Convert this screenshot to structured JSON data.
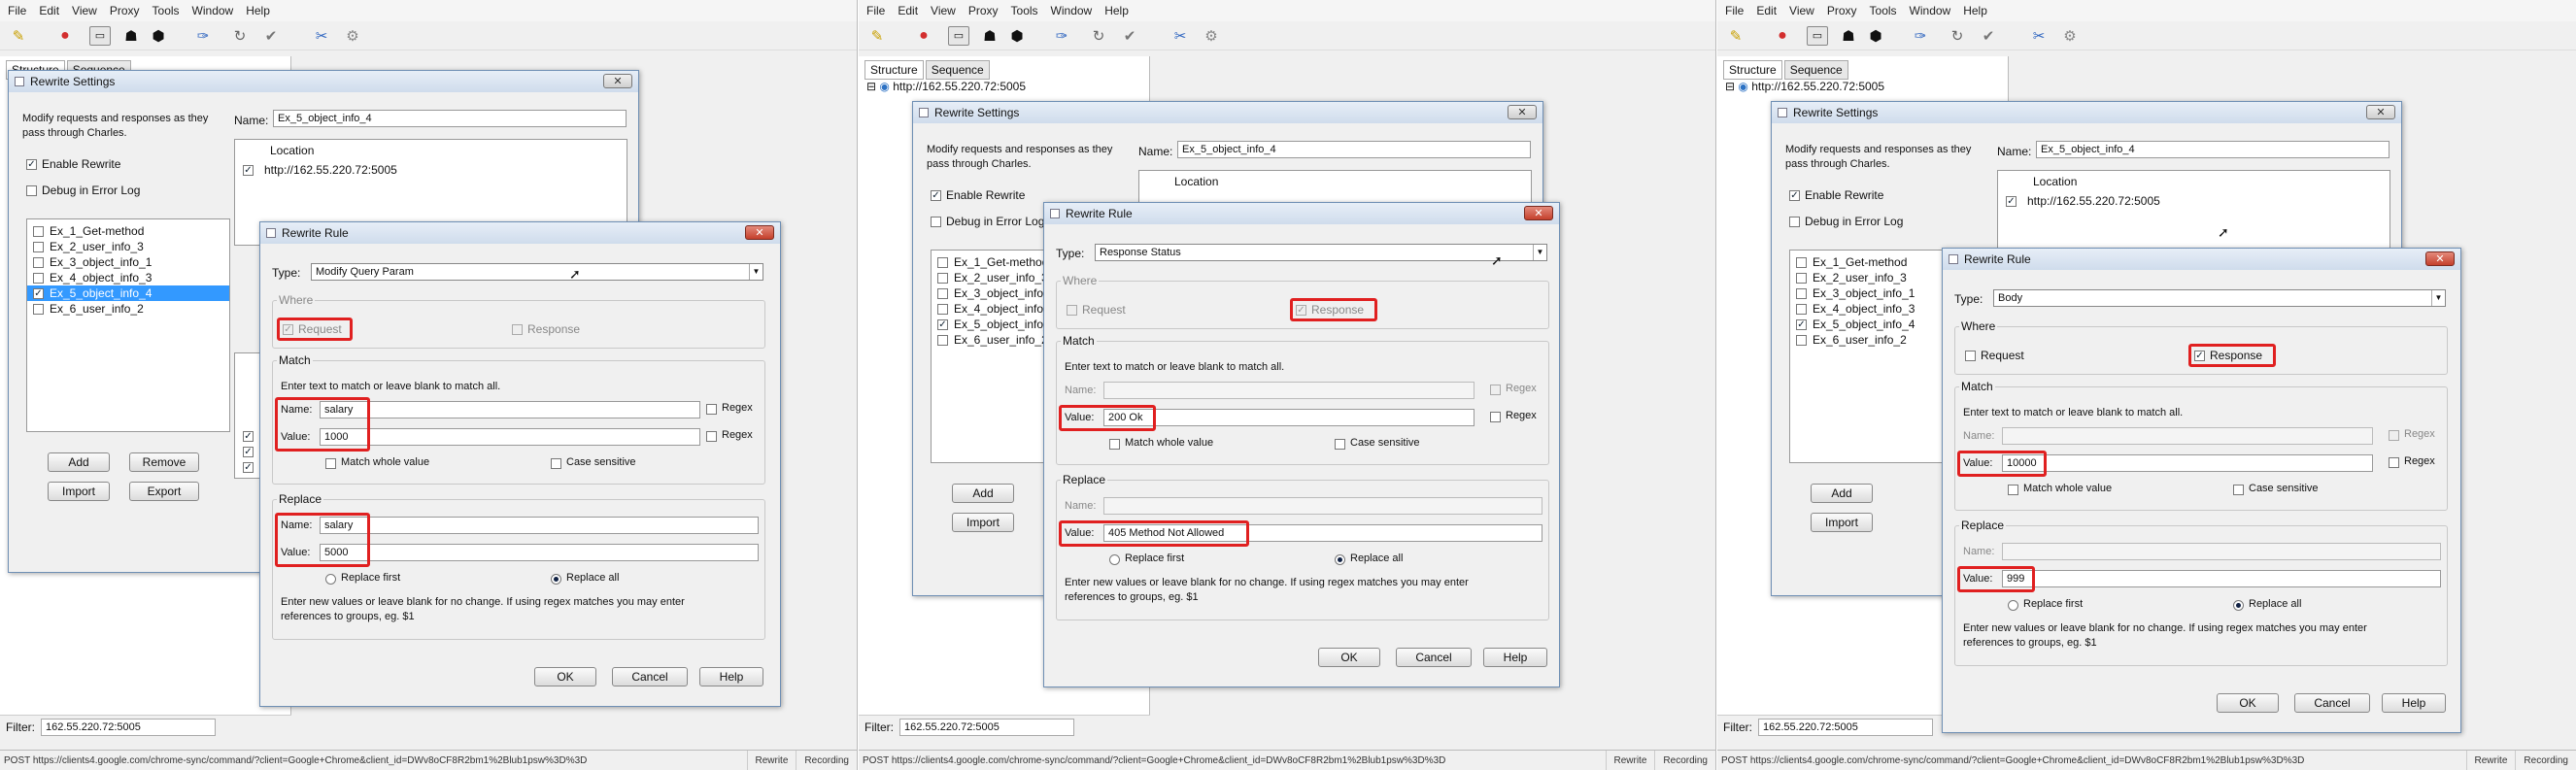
{
  "menu": [
    "File",
    "Edit",
    "View",
    "Proxy",
    "Tools",
    "Window",
    "Help"
  ],
  "left_tabs": {
    "structure": "Structure",
    "sequence": "Sequence"
  },
  "tree_host": "http://162.55.220.72:5005",
  "filter": {
    "label": "Filter:",
    "value": "162.55.220.72:5005"
  },
  "status": {
    "url": "POST https://clients4.google.com/chrome-sync/command/?client=Google+Chrome&client_id=DWv8oCF8R2bm1%2Blub1psw%3D%3D",
    "rewrite": "Rewrite",
    "recording": "Recording"
  },
  "settings": {
    "title": "Rewrite Settings",
    "description": "Modify requests and responses as they pass through Charles.",
    "enable_rewrite": "Enable Rewrite",
    "debug_log": "Debug in Error Log",
    "name_label": "Name:",
    "name_value": "Ex_5_object_info_4",
    "location_header": "Location",
    "location_value": "http://162.55.220.72:5005",
    "sets": [
      "Ex_1_Get-method",
      "Ex_2_user_info_3",
      "Ex_3_object_info_1",
      "Ex_4_object_info_3",
      "Ex_5_object_info_4",
      "Ex_6_user_info_2"
    ],
    "add": "Add",
    "remove": "Remove",
    "import": "Import",
    "export": "Export"
  },
  "rule_common": {
    "title": "Rewrite Rule",
    "type_label": "Type:",
    "where": "Where",
    "request": "Request",
    "response": "Response",
    "match": "Match",
    "match_help": "Enter text to match or leave blank to match all.",
    "name_label": "Name:",
    "value_label": "Value:",
    "regex": "Regex",
    "match_whole": "Match whole value",
    "case_sensitive": "Case sensitive",
    "replace": "Replace",
    "replace_first": "Replace first",
    "replace_all": "Replace all",
    "replace_help": "Enter new values or leave blank for no change. If using regex matches you may enter references to groups, eg. $1",
    "ok": "OK",
    "cancel": "Cancel",
    "help": "Help"
  },
  "rules": [
    {
      "type": "Modify Query Param",
      "match_name": "salary",
      "match_value": "1000",
      "replace_name": "salary",
      "replace_value": "5000"
    },
    {
      "type": "Response Status",
      "match_name": "",
      "match_value": "200 Ok",
      "replace_name": "",
      "replace_value": "405 Method Not Allowed"
    },
    {
      "type": "Body",
      "match_name": "",
      "match_value": "10000",
      "replace_name": "",
      "replace_value": "999"
    }
  ],
  "colors": {
    "highlight": "#e02020",
    "selection": "#3399ff"
  }
}
